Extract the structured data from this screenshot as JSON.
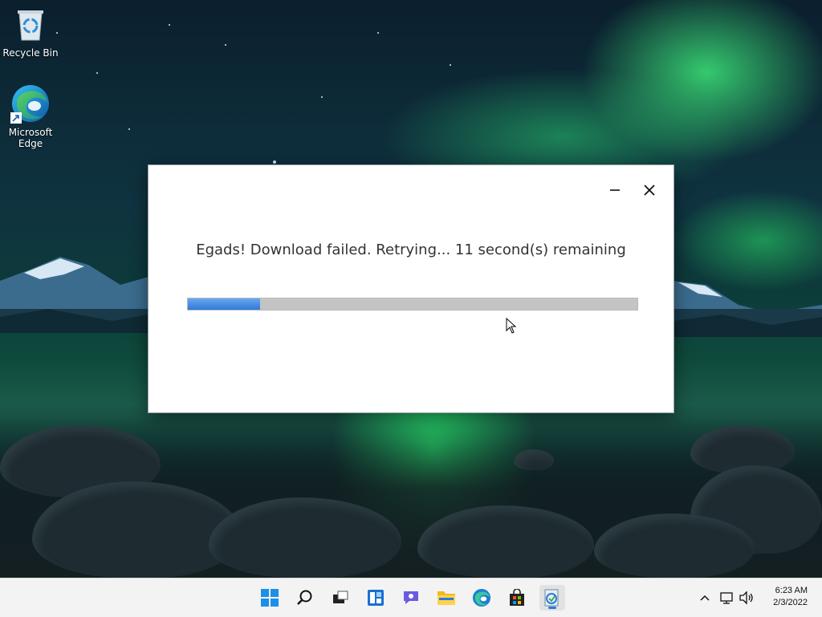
{
  "desktop": {
    "icons": [
      {
        "label": "Recycle Bin"
      },
      {
        "label": "Microsoft Edge"
      }
    ]
  },
  "dialog": {
    "message": "Egads! Download failed. Retrying... 11 second(s) remaining",
    "progress_fraction": 0.16,
    "minimize_icon": "minimize-icon",
    "close_icon": "close-icon"
  },
  "taskbar": {
    "items": [
      "start",
      "search",
      "task-view",
      "widgets",
      "chat",
      "file-explorer",
      "edge",
      "store",
      "installer-app"
    ],
    "active_item": "installer-app",
    "tray": {
      "icons": [
        "chevron-up-icon",
        "network-icon",
        "volume-icon"
      ],
      "time": "6:23 AM",
      "date": "2/3/2022"
    }
  },
  "colors": {
    "progress_fill": "#2f7ad8",
    "progress_track": "#c4c4c4",
    "accent": "#2a7bd8"
  }
}
